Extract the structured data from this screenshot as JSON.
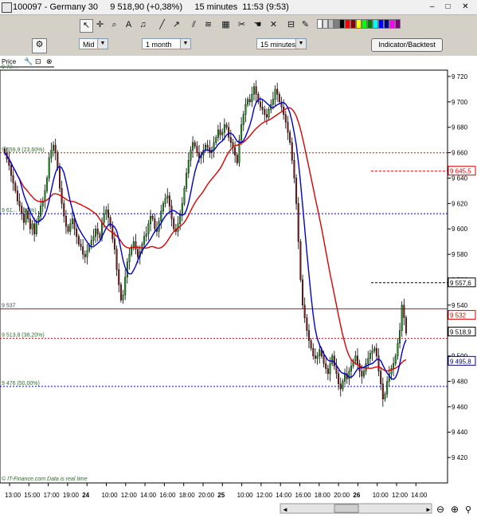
{
  "window": {
    "title": "100097 - Germany 30     9 518,90 (+0,38%)     15 minutes  11:53 (9:53)",
    "minimize": "–",
    "maximize": "□",
    "close": "✕"
  },
  "toolbar": {
    "price_combo": "Mid",
    "period_combo": "1 month",
    "interval_combo": "15 minutes",
    "indicator_button": "Indicator/Backtest",
    "palette": [
      "#ffffff",
      "#e0e0e0",
      "#c0c0c0",
      "#808080",
      "#000000",
      "#ff0000",
      "#800000",
      "#ffff00",
      "#00ff00",
      "#008000",
      "#00ffff",
      "#0000ff",
      "#000080",
      "#ff00ff",
      "#800080"
    ],
    "icons": [
      "cursor-icon",
      "crosshair-icon",
      "zoom-icon",
      "text-icon",
      "alarm-icon",
      "line-icon",
      "trend-icon",
      "channel-icon",
      "fibonacci-icon",
      "grid-icon",
      "cut-icon",
      "hand-icon",
      "delete-icon"
    ]
  },
  "panel": {
    "label": "Price"
  },
  "chart_data": {
    "type": "candlestick",
    "instrument": "Germany 30",
    "interval": "15 minutes",
    "ylim": [
      9400,
      9725
    ],
    "y_ticks": [
      9420,
      9440,
      9460,
      9480,
      9500,
      9520,
      9540,
      9560,
      9580,
      9600,
      9620,
      9640,
      9660,
      9680,
      9700,
      9720
    ],
    "y_tick_labels": [
      "9 420",
      "9 440",
      "9 460",
      "9 480",
      "9 500",
      "9 520",
      "9 540",
      "9 560",
      "9 580",
      "9 600",
      "9 620",
      "9 640",
      "9 660",
      "9 680",
      "9 700",
      "9 720"
    ],
    "x_tick_labels": [
      "13:00",
      "15:00",
      "17:00",
      "19:00",
      "24",
      "10:00",
      "12:00",
      "14:00",
      "16:00",
      "18:00",
      "20:00",
      "25",
      "10:00",
      "12:00",
      "14:00",
      "16:00",
      "18:00",
      "20:00",
      "26",
      "10:00",
      "12:00",
      "14:00"
    ],
    "fibonacci": [
      {
        "label": "9 659,9 (23,60%)",
        "value": 9659.9
      },
      {
        "label": "9 61... ...80%)",
        "value": 9612
      },
      {
        "label": "9 537",
        "value": 9537
      },
      {
        "label": "9 513,8 (38,20%)",
        "value": 9513.8
      },
      {
        "label": "9 476 (50,00%)",
        "value": 9476
      }
    ],
    "top_partial_label": "9 72…",
    "right_markers": [
      {
        "label": "9 645,5",
        "value": 9645.5,
        "color": "#dd0000"
      },
      {
        "label": "9 557,6",
        "value": 9557.6,
        "color": "#000000"
      },
      {
        "label": "9 532",
        "value": 9532,
        "color": "#dd0000"
      },
      {
        "label": "9 518,9",
        "value": 9518.9,
        "color": "#000000"
      },
      {
        "label": "9 495,8",
        "value": 9495.8,
        "color": "#000088"
      }
    ],
    "price_line": 9537,
    "close_series": [
      9660,
      9655,
      9650,
      9642,
      9636,
      9630,
      9622,
      9618,
      9612,
      9605,
      9614,
      9608,
      9600,
      9604,
      9596,
      9606,
      9610,
      9618,
      9622,
      9630,
      9640,
      9656,
      9662,
      9666,
      9660,
      9648,
      9632,
      9620,
      9610,
      9602,
      9598,
      9604,
      9608,
      9600,
      9594,
      9588,
      9586,
      9580,
      9578,
      9583,
      9587,
      9591,
      9594,
      9600,
      9596,
      9593,
      9605,
      9612,
      9615,
      9609,
      9602,
      9592,
      9584,
      9568,
      9556,
      9544,
      9548,
      9562,
      9574,
      9580,
      9586,
      9590,
      9584,
      9578,
      9582,
      9588,
      9594,
      9596,
      9604,
      9610,
      9608,
      9600,
      9598,
      9606,
      9614,
      9620,
      9624,
      9626,
      9618,
      9608,
      9600,
      9598,
      9604,
      9612,
      9620,
      9632,
      9644,
      9654,
      9662,
      9668,
      9665,
      9660,
      9656,
      9658,
      9662,
      9666,
      9664,
      9660,
      9662,
      9668,
      9672,
      9678,
      9674,
      9676,
      9682,
      9680,
      9672,
      9668,
      9664,
      9658,
      9652,
      9670,
      9682,
      9690,
      9698,
      9702,
      9700,
      9706,
      9712,
      9706,
      9700,
      9696,
      9694,
      9690,
      9688,
      9694,
      9698,
      9702,
      9710,
      9706,
      9700,
      9696,
      9690,
      9684,
      9676,
      9668,
      9654,
      9640,
      9620,
      9590,
      9560,
      9540,
      9530,
      9520,
      9512,
      9506,
      9500,
      9498,
      9500,
      9505,
      9500,
      9494,
      9490,
      9486,
      9494,
      9500,
      9492,
      9486,
      9478,
      9474,
      9480,
      9486,
      9482,
      9488,
      9492,
      9496,
      9500,
      9494,
      9488,
      9484,
      9488,
      9494,
      9498,
      9502,
      9504,
      9506,
      9500,
      9488,
      9478,
      9466,
      9470,
      9480,
      9486,
      9490,
      9494,
      9500,
      9510,
      9520,
      9540,
      9530,
      9518
    ],
    "ma_fast_color": "#0000cc",
    "ma_slow_color": "#dd0000",
    "watermark": "© IT-Finance.com  Data is real time"
  },
  "scrollbar": {
    "left_arrow": "◄",
    "right_arrow": "►"
  },
  "zoom": {
    "zoom_out": "⊖",
    "zoom_in": "⊕"
  }
}
